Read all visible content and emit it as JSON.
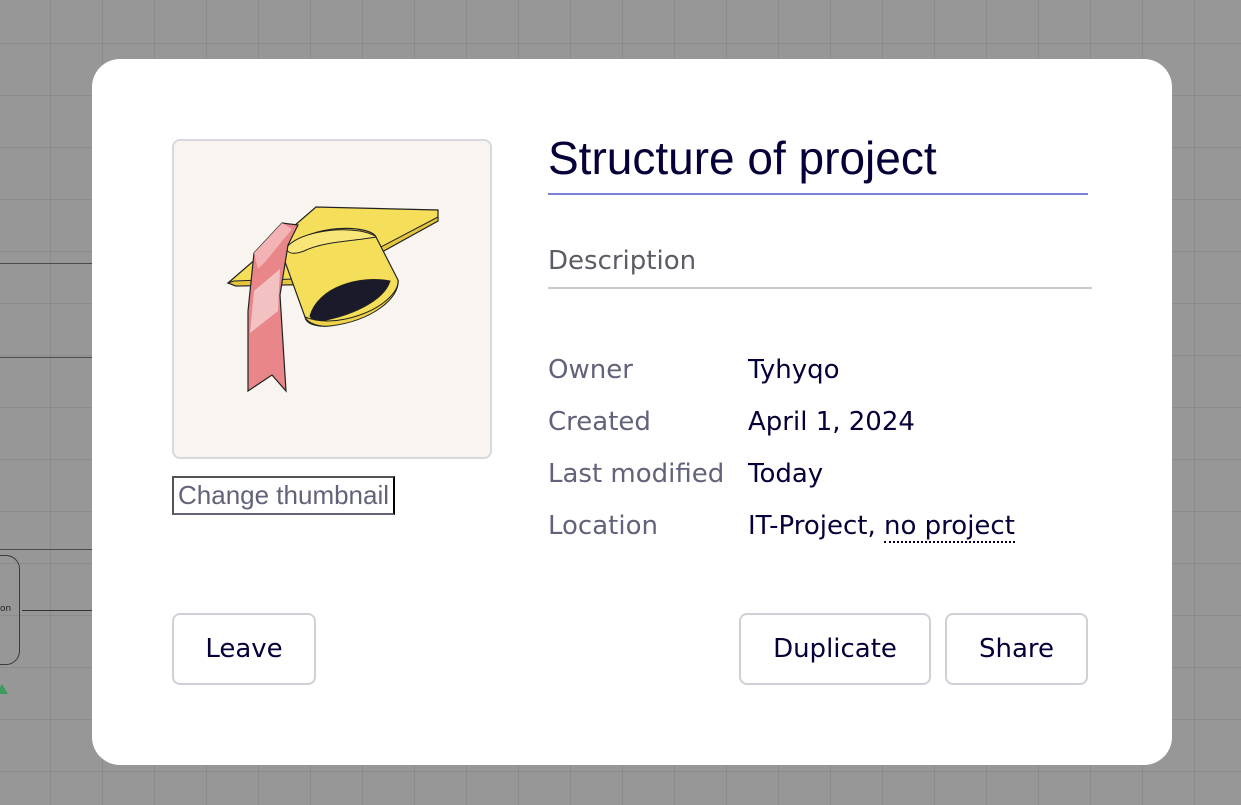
{
  "board": {
    "title": "Structure of project",
    "description_placeholder": "Description",
    "change_thumbnail_label": "Change thumbnail"
  },
  "info": {
    "owner_label": "Owner",
    "owner_value": "Tyhyqo",
    "created_label": "Created",
    "created_value": "April 1, 2024",
    "modified_label": "Last modified",
    "modified_value": "Today",
    "location_label": "Location",
    "location_team": "IT-Project,",
    "location_project": "no project"
  },
  "actions": {
    "leave_label": "Leave",
    "duplicate_label": "Duplicate",
    "share_label": "Share"
  },
  "background": {
    "node_text": "on"
  },
  "colors": {
    "title_underline": "#7b82d6",
    "text_primary": "#050038",
    "text_secondary": "#62637a",
    "thumbnail_bg": "#f8f5f0",
    "cap_yellow": "#f5df5a",
    "ribbon_pink": "#e8868a"
  },
  "icons": {
    "thumbnail": "graduation-cap-icon"
  }
}
